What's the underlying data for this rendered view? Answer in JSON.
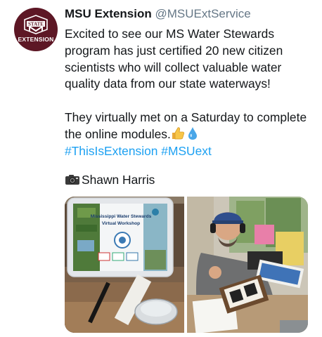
{
  "tweet": {
    "display_name": "MSU Extension",
    "handle": "@MSUExtService",
    "avatar_text": "EXTENSION",
    "avatar_crest_text": "STATE",
    "body_line1": "Excited to see our MS Water Stewards program has just certified 20 new citizen scientists who will collect valuable water quality data from our state waterways!",
    "body_line2": "They virtually met on a Saturday to complete the online modules.",
    "hashtag1": "#ThisIsExtension",
    "hashtag2": "#MSUext",
    "photo_credit": "Shawn Harris",
    "emoji": [
      "thumbs-up-icon",
      "droplet-icon",
      "camera-icon"
    ]
  },
  "tablet_screen": {
    "title_line1": "Mississippi Water Stewards",
    "title_line2": "Virtual Workshop"
  },
  "colors": {
    "brand_maroon": "#5d1725",
    "hashtag_blue": "#1da1f2",
    "handle_gray": "#657786"
  }
}
